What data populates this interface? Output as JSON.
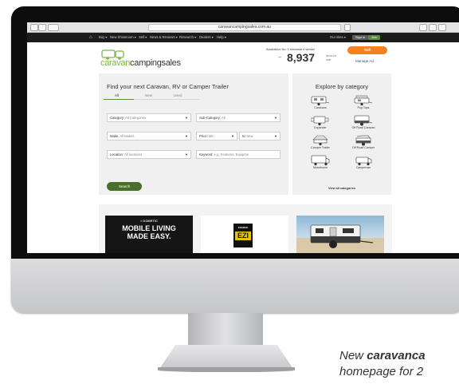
{
  "browser": {
    "url": "caravancampingsales.com.au"
  },
  "nav": {
    "items": [
      "Buy ▾",
      "New Showroom ▾",
      "Sell ▾",
      "News & Reviews ▾",
      "Research ▾",
      "Dealers ▾",
      "Help ▾"
    ],
    "my_sites": "Our sites ▾",
    "sign_in": "Sign in",
    "join": "Join"
  },
  "header": {
    "logo_part1": "caravan",
    "logo_part2": "campingsales",
    "tagline": "Australia's No. 1 because it works!",
    "count_prefix": "~",
    "listing_count": "8,937",
    "count_label": "items for sale",
    "sell_label": "Sell",
    "manage_ad_label": "Manage Ad"
  },
  "search": {
    "title": "Find your next Caravan, RV or Camper Trailer",
    "tabs": [
      "All",
      "New",
      "Used"
    ],
    "fields": {
      "category": {
        "label": "Category:",
        "value": "All Categories"
      },
      "subcategory": {
        "label": "Sub-Category:",
        "value": "All"
      },
      "make": {
        "label": "Make:",
        "value": "All Makes"
      },
      "price": {
        "label": "Price:",
        "min": "Min",
        "to": "to:",
        "max": "Max"
      },
      "location": {
        "label": "Location:",
        "value": "All locations"
      },
      "keyword": {
        "label": "Keyword:",
        "placeholder": "e.g. Features, Equipme"
      }
    },
    "button_label": "Search"
  },
  "explore": {
    "title": "Explore by category",
    "categories": [
      "Caravans",
      "Pop Tops",
      "Expander",
      "Off Road Caravan",
      "Camper Trailer",
      "Off Road Camper",
      "Motorhome",
      "Campervan"
    ],
    "view_all": "View all categories"
  },
  "ads": {
    "dometic_logo": "≈ DOMETIC",
    "dometic_line1": "MOBILE LIVING",
    "dometic_line2": "MADE EASY.",
    "france_small": "FRANCE",
    "france_big": "EZI"
  },
  "caption": {
    "prefix": "New ",
    "brand": "caravanca",
    "line2": "homepage for 2"
  },
  "colors": {
    "brand_green": "#7ab648",
    "search_button": "#4a6f2d",
    "sell_button": "#f58220",
    "nav_bar": "#1b1b1c"
  }
}
